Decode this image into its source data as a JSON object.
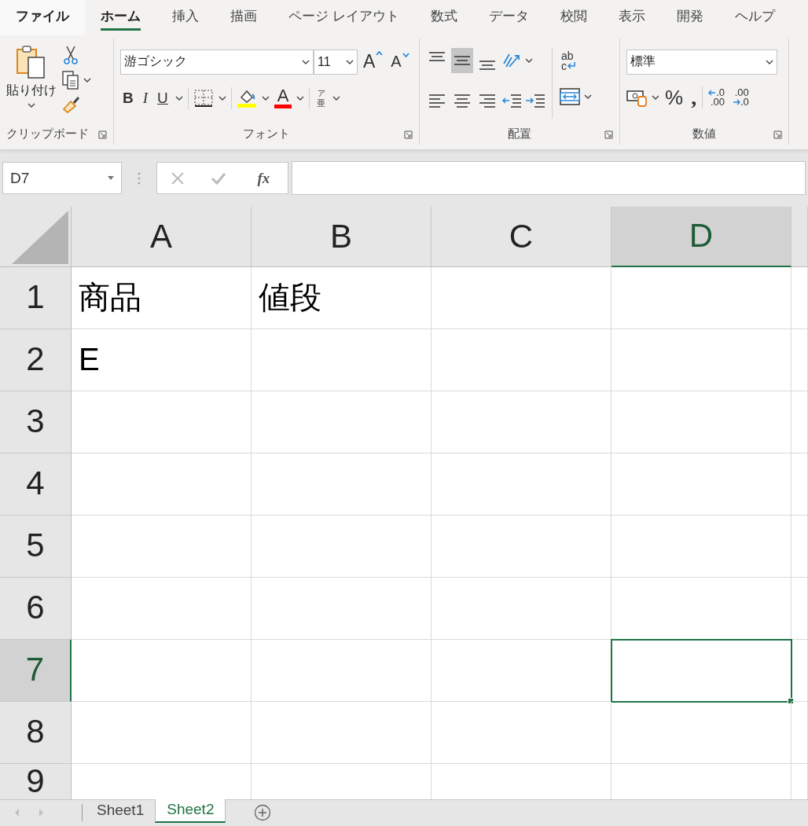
{
  "menu_tabs": [
    {
      "label": "ファイル",
      "selected": false
    },
    {
      "label": "ホーム",
      "selected": true
    },
    {
      "label": "挿入",
      "selected": false
    },
    {
      "label": "描画",
      "selected": false
    },
    {
      "label": "ページ レイアウト",
      "selected": false
    },
    {
      "label": "数式",
      "selected": false
    },
    {
      "label": "データ",
      "selected": false
    },
    {
      "label": "校閲",
      "selected": false
    },
    {
      "label": "表示",
      "selected": false
    },
    {
      "label": "開発",
      "selected": false
    },
    {
      "label": "ヘルプ",
      "selected": false
    }
  ],
  "ribbon": {
    "clipboard": {
      "paste_label": "貼り付け",
      "group_label": "クリップボード"
    },
    "font": {
      "font_name": "游ゴシック",
      "font_size": "11",
      "grow_label": "A",
      "shrink_label": "A",
      "bold_label": "B",
      "italic_label": "I",
      "underline_label": "U",
      "font_color_label": "A",
      "phonetic_top": "ア",
      "phonetic_bottom": "亜",
      "group_label": "フォント"
    },
    "alignment": {
      "vertical_buttons": [
        {
          "kind": "top",
          "selected": false
        },
        {
          "kind": "middle",
          "selected": true
        },
        {
          "kind": "bottom",
          "selected": false
        }
      ],
      "horizontal_buttons": [
        {
          "kind": "left",
          "selected": false
        },
        {
          "kind": "center",
          "selected": false
        },
        {
          "kind": "right",
          "selected": false
        }
      ],
      "wrap_top": "ab",
      "wrap_bottom": "c",
      "group_label": "配置"
    },
    "number": {
      "format": "標準",
      "percent_label": "%",
      "comma_label": ",",
      "increase_decimal": [
        ".0",
        ".00"
      ],
      "decrease_decimal": [
        ".00",
        ".0"
      ],
      "group_label": "数値"
    }
  },
  "formula_bar": {
    "name_box": "D7",
    "function_label": "fx"
  },
  "columns": [
    {
      "label": "A",
      "selected": false
    },
    {
      "label": "B",
      "selected": false
    },
    {
      "label": "C",
      "selected": false
    },
    {
      "label": "D",
      "selected": true
    }
  ],
  "rows": [
    {
      "label": "1",
      "selected": false,
      "cells": [
        "商品",
        "値段"
      ]
    },
    {
      "label": "2",
      "selected": false,
      "cells": [
        "E"
      ]
    },
    {
      "label": "3",
      "selected": false
    },
    {
      "label": "4",
      "selected": false
    },
    {
      "label": "5",
      "selected": false
    },
    {
      "label": "6",
      "selected": false
    },
    {
      "label": "7",
      "selected": true
    },
    {
      "label": "8",
      "selected": false
    },
    {
      "label": "9",
      "selected": false
    }
  ],
  "sheet_tabs": [
    {
      "label": "Sheet1",
      "selected": false
    },
    {
      "label": "Sheet2",
      "selected": true
    }
  ]
}
